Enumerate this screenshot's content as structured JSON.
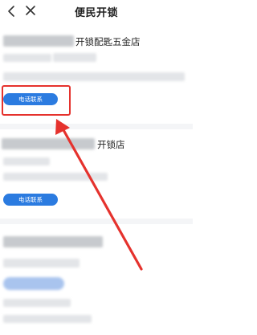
{
  "header": {
    "title": "便民开锁",
    "back_icon": "chevron-left-icon",
    "close_icon": "close-icon"
  },
  "listings": [
    {
      "name_suffix": "开锁配匙五金店",
      "call_label": "电话联系"
    },
    {
      "name_suffix": "开锁店",
      "call_label": "电话联系"
    }
  ],
  "colors": {
    "accent": "#2b7be0",
    "highlight": "#e5322d"
  }
}
